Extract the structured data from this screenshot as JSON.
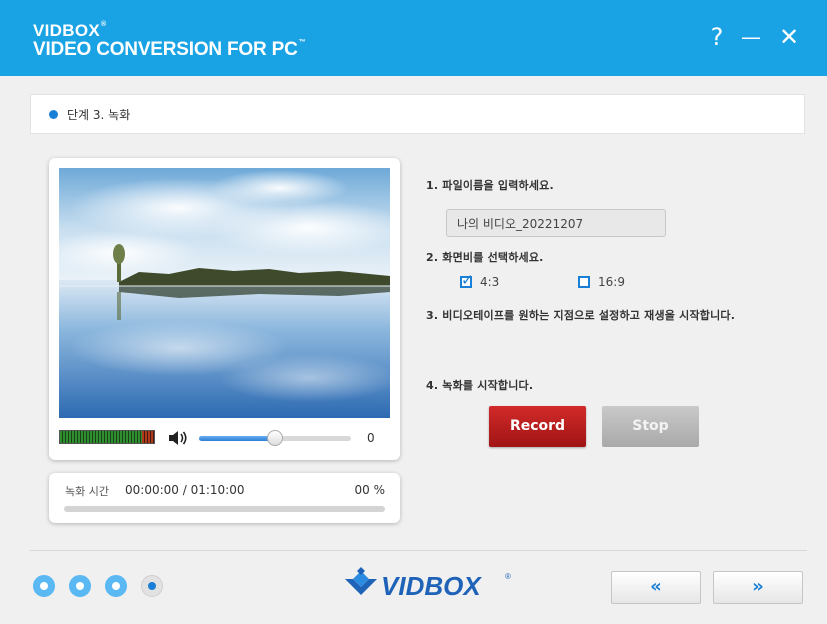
{
  "app": {
    "brand_top": "VIDBOX",
    "brand_top_mark": "®",
    "brand_bottom": "VIDEO CONVERSION FOR PC",
    "brand_bottom_mark": "™",
    "help_glyph": "?",
    "minimize_glyph": "—",
    "close_glyph": "✕"
  },
  "step": {
    "label": "단계 3. 녹화"
  },
  "player": {
    "volume_value": "0",
    "volume_level": 0.5
  },
  "record_time": {
    "label": "녹화 시간",
    "value": "00:00:00 / 01:10:00",
    "percent": "00 %",
    "progress": 0
  },
  "instructions": {
    "step1": "1. 파일이름을 입력하세요.",
    "step2": "2. 화면비를 선택하세요.",
    "step3": "3. 비디오테이프를 원하는 지점으로 설정하고 재생을 시작합니다.",
    "step4": "4. 녹화를 시작합니다."
  },
  "filename": {
    "value": "나의 비디오_20221207"
  },
  "aspect_ratio": {
    "options": [
      {
        "label": "4:3",
        "checked": true
      },
      {
        "label": "16:9",
        "checked": false
      }
    ]
  },
  "buttons": {
    "record": "Record",
    "stop": "Stop"
  },
  "footer": {
    "logo_text": "VIDBOX",
    "logo_mark": "®",
    "back_glyph": "«",
    "next_glyph": "»",
    "current_step": 4,
    "total_steps": 4
  },
  "colors": {
    "header": "#1aa3e4",
    "accent": "#1a7fd6",
    "record": "#c01f1f",
    "stop": "#b8b8b8"
  }
}
